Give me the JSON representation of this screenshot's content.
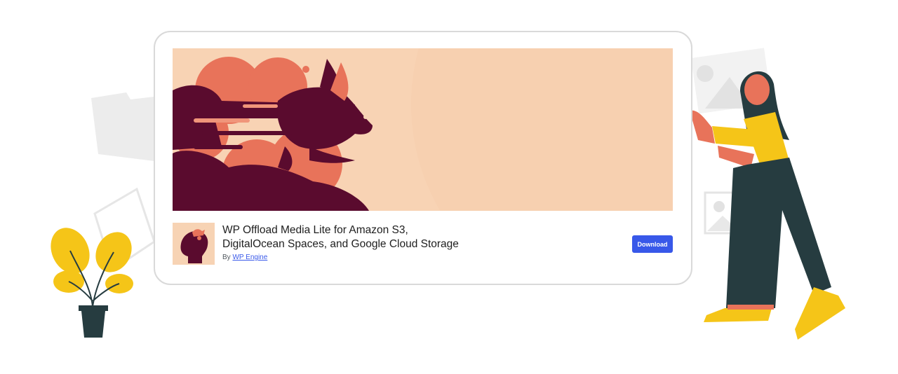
{
  "plugin": {
    "title_line1": "WP Offload Media Lite for Amazon S3,",
    "title_line2": "DigitalOcean Spaces, and Google Cloud Storage",
    "author_prefix": "By",
    "author_name": "WP Engine",
    "download_label": "Download"
  },
  "colors": {
    "banner_bg": "#f8d3b4",
    "banner_dark": "#5a0b2e",
    "banner_coral": "#e8735a",
    "button_bg": "#3858e9",
    "link": "#3858e9"
  },
  "illustration": {
    "left": "potted-plant-illustration",
    "right": "woman-holding-card-illustration",
    "background": "folder-and-image-placeholder-icons"
  }
}
